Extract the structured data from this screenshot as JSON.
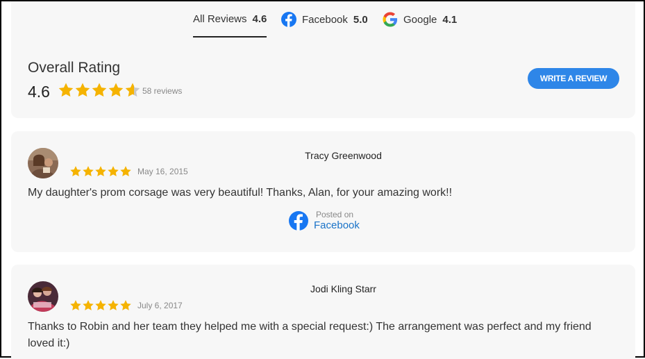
{
  "tabs": [
    {
      "label": "All Reviews",
      "value": "4.6",
      "icon": "none",
      "active": true
    },
    {
      "label": "Facebook",
      "value": "5.0",
      "icon": "facebook-icon",
      "active": false
    },
    {
      "label": "Google",
      "value": "4.1",
      "icon": "google-icon",
      "active": false
    }
  ],
  "summary": {
    "title": "Overall Rating",
    "average": "4.6",
    "average_stars": 4.6,
    "count": "58 reviews",
    "write_button": "WRITE A REVIEW"
  },
  "reviews": [
    {
      "name": "Tracy Greenwood",
      "date": "May 16, 2015",
      "stars": 5,
      "text": "My daughter's prom corsage was very beautiful! Thanks, Alan, for your amazing work!!",
      "posted_label": "Posted on",
      "posted_source": "Facebook"
    },
    {
      "name": "Jodi Kling Starr",
      "date": "July 6, 2017",
      "stars": 5,
      "text": "Thanks to Robin and her team they helped me with a special request:) The arrangement was perfect and my friend loved it:)"
    }
  ],
  "colors": {
    "star": "#f5b301",
    "accent": "#2e86e8",
    "facebook": "#1877f2",
    "card_bg": "#f7f7f7"
  }
}
